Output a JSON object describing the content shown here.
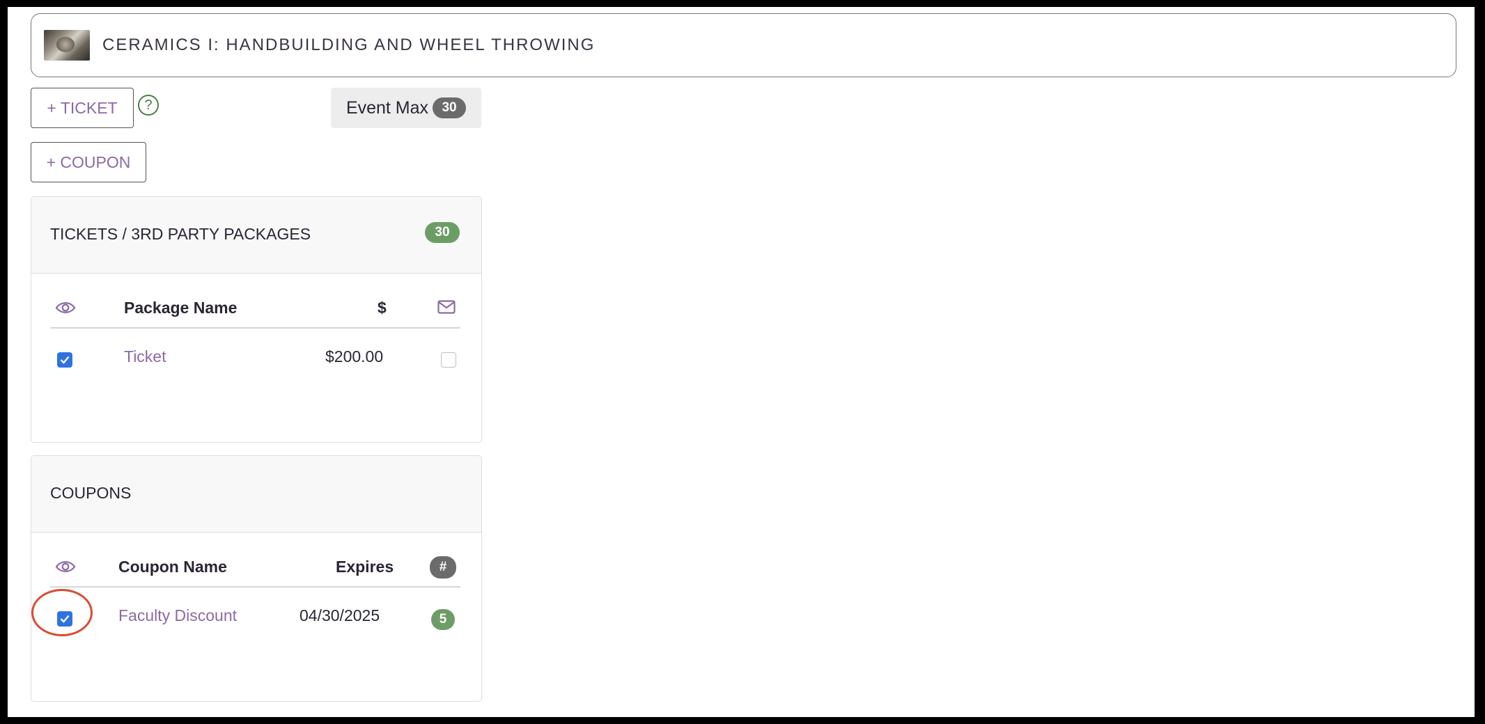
{
  "event": {
    "title": "CERAMICS I: HANDBUILDING AND WHEEL THROWING"
  },
  "toolbar": {
    "add_ticket_label": "+ TICKET",
    "help_glyph": "?",
    "add_coupon_label": "+ COUPON",
    "event_max_label": "Event Max",
    "event_max_value": "30"
  },
  "tickets": {
    "title": "TICKETS / 3RD PARTY PACKAGES",
    "count": "30",
    "columns": {
      "visible_icon": "eye-icon",
      "name": "Package Name",
      "price": "$",
      "email_icon": "envelope-icon"
    },
    "rows": [
      {
        "name": "Ticket",
        "price": "$200.00",
        "visible": true,
        "email": false
      }
    ]
  },
  "coupons": {
    "title": "COUPONS",
    "columns": {
      "visible_icon": "eye-icon",
      "name": "Coupon Name",
      "expires": "Expires",
      "count": "#"
    },
    "rows": [
      {
        "name": "Faculty Discount",
        "expires": "04/30/2025",
        "count": "5",
        "visible": true
      }
    ]
  },
  "colors": {
    "accent_purple": "#8a6aa6",
    "badge_green": "#6c9d66",
    "badge_grey": "#6b6b6b",
    "checkbox_blue": "#2f73e3",
    "help_green": "#4f7d48",
    "annotation_red": "#d94b32"
  }
}
